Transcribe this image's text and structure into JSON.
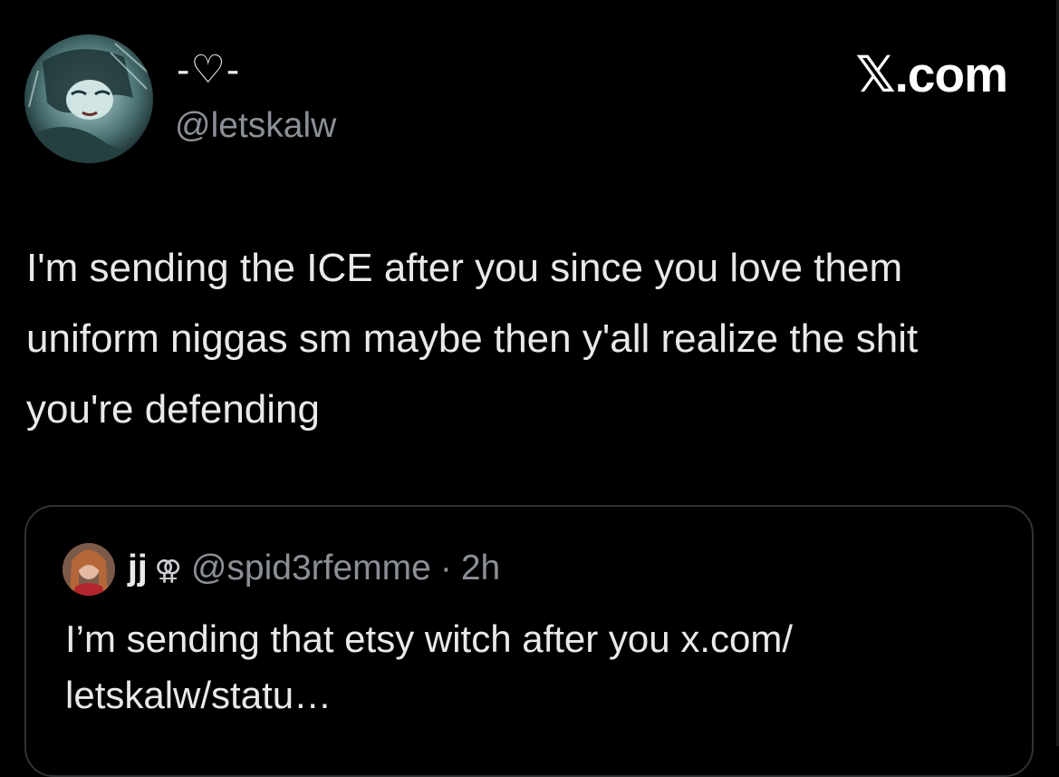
{
  "post": {
    "author_display_name": "-♡-",
    "author_handle": "@letskalw",
    "text": "I'm sending the ICE after you since you love them uniform niggas sm maybe then y'all realize the shit you're defending"
  },
  "brand": {
    "label": "𝕏.com"
  },
  "quoted_post": {
    "author_display_name": "jj",
    "author_flag": "⚢",
    "author_handle": "@spid3rfemme",
    "separator": "·",
    "timestamp": "2h",
    "text": "I’m sending that etsy witch after you x.com/ letskalw/statu…"
  },
  "icons": {
    "author_avatar": "avatar-image",
    "quoted_avatar": "avatar-image"
  },
  "colors": {
    "background": "#000000",
    "primary_text": "#e7e9ea",
    "secondary_text": "#8b9096",
    "card_border": "#2f3336"
  }
}
